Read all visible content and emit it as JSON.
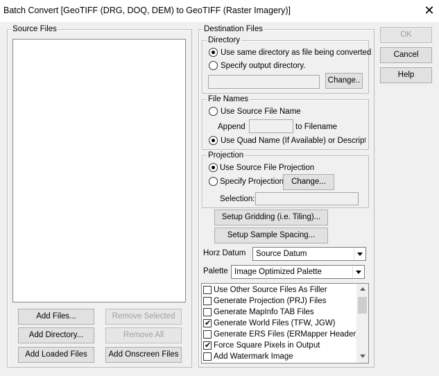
{
  "window": {
    "title": "Batch Convert [GeoTIFF (DRG, DOQ, DEM) to GeoTIFF (Raster Imagery)]",
    "close_glyph": "✕"
  },
  "source_files": {
    "legend": "Source Files",
    "buttons": {
      "add_files": "Add Files...",
      "remove_selected": "Remove Selected",
      "add_directory": "Add Directory...",
      "remove_all": "Remove All",
      "add_loaded": "Add Loaded Files",
      "add_onscreen": "Add Onscreen Files"
    }
  },
  "destination": {
    "legend": "Destination Files",
    "directory": {
      "legend": "Directory",
      "same_dir_label": "Use same directory as file being converted",
      "specify_dir_label": "Specify output directory.",
      "path_value": "",
      "change_label": "Change.."
    },
    "file_names": {
      "legend": "File Names",
      "source_name_label": "Use Source File Name",
      "append_label": "Append",
      "append_value": "",
      "to_filename_label": "to Filename",
      "quad_name_label": "Use Quad Name (If Available) or Descriptior"
    },
    "projection": {
      "legend": "Projection",
      "source_proj_label": "Use Source File Projection",
      "specify_proj_label": "Specify Projection",
      "change_label": "Change...",
      "selection_label": "Selection:",
      "selection_value": ""
    },
    "setup_gridding": "Setup Gridding (i.e. Tiling)...",
    "setup_spacing": "Setup Sample Spacing...",
    "horz_datum_label": "Horz Datum",
    "horz_datum_value": "Source Datum",
    "palette_label": "Palette",
    "palette_value": "Image Optimized Palette",
    "options": [
      {
        "label": "Use Other Source Files As Filler",
        "checked": false
      },
      {
        "label": "Generate Projection (PRJ) Files",
        "checked": false
      },
      {
        "label": "Generate MapInfo TAB Files",
        "checked": false
      },
      {
        "label": "Generate World Files (TFW, JGW)",
        "checked": true
      },
      {
        "label": "Generate ERS Files (ERMapper Header)",
        "checked": false
      },
      {
        "label": "Force Square Pixels in Output",
        "checked": true
      },
      {
        "label": "Add Watermark Image",
        "checked": false
      }
    ]
  },
  "dialog_buttons": {
    "ok": "OK",
    "cancel": "Cancel",
    "help": "Help"
  }
}
